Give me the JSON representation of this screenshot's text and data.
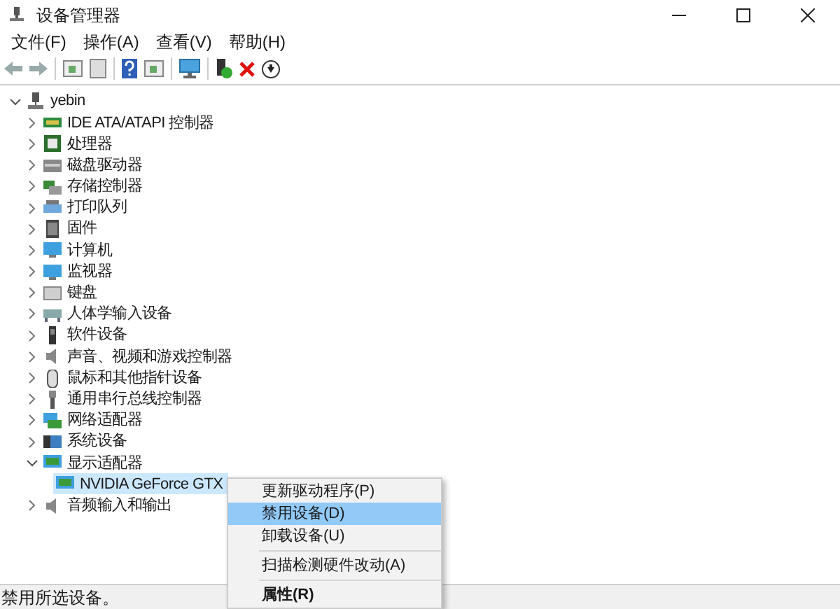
{
  "window": {
    "title": "设备管理器"
  },
  "menu_bar": [
    {
      "label": "文件(F)"
    },
    {
      "label": "操作(A)"
    },
    {
      "label": "查看(V)"
    },
    {
      "label": "帮助(H)"
    }
  ],
  "tree": {
    "label": "yebin",
    "expanded": true,
    "selected": false,
    "children": [
      {
        "label": "IDE ATA/ATAPI 控制器",
        "expanded": false,
        "selected": false
      },
      {
        "label": "处理器",
        "expanded": false,
        "selected": false
      },
      {
        "label": "磁盘驱动器",
        "expanded": false,
        "selected": false
      },
      {
        "label": "存储控制器",
        "expanded": false,
        "selected": false
      },
      {
        "label": "打印队列",
        "expanded": false,
        "selected": false
      },
      {
        "label": "固件",
        "expanded": false,
        "selected": false
      },
      {
        "label": "计算机",
        "expanded": false,
        "selected": false
      },
      {
        "label": "监视器",
        "expanded": false,
        "selected": false
      },
      {
        "label": "键盘",
        "expanded": false,
        "selected": false
      },
      {
        "label": "人体学输入设备",
        "expanded": false,
        "selected": false
      },
      {
        "label": "软件设备",
        "expanded": false,
        "selected": false
      },
      {
        "label": "声音、视频和游戏控制器",
        "expanded": false,
        "selected": false
      },
      {
        "label": "鼠标和其他指针设备",
        "expanded": false,
        "selected": false
      },
      {
        "label": "通用串行总线控制器",
        "expanded": false,
        "selected": false
      },
      {
        "label": "网络适配器",
        "expanded": false,
        "selected": false
      },
      {
        "label": "系统设备",
        "expanded": false,
        "selected": false
      },
      {
        "label": "显示适配器",
        "expanded": true,
        "selected": false,
        "children": [
          {
            "label": "NVIDIA GeForce GTX",
            "selected": true
          }
        ]
      },
      {
        "label": "音频输入和输出",
        "expanded": false,
        "selected": false
      }
    ]
  },
  "context_menu": {
    "items": [
      {
        "kind": "item",
        "label": "更新驱动程序(P)",
        "selected": false
      },
      {
        "kind": "item",
        "label": "禁用设备(D)",
        "selected": true
      },
      {
        "kind": "item",
        "label": "卸载设备(U)",
        "selected": false
      },
      {
        "kind": "separator"
      },
      {
        "kind": "item",
        "label": "扫描检测硬件改动(A)",
        "selected": false
      },
      {
        "kind": "separator"
      },
      {
        "kind": "default",
        "label": "属性(R)",
        "selected": false
      }
    ]
  },
  "status_bar": {
    "text": "禁用所选设备。"
  }
}
